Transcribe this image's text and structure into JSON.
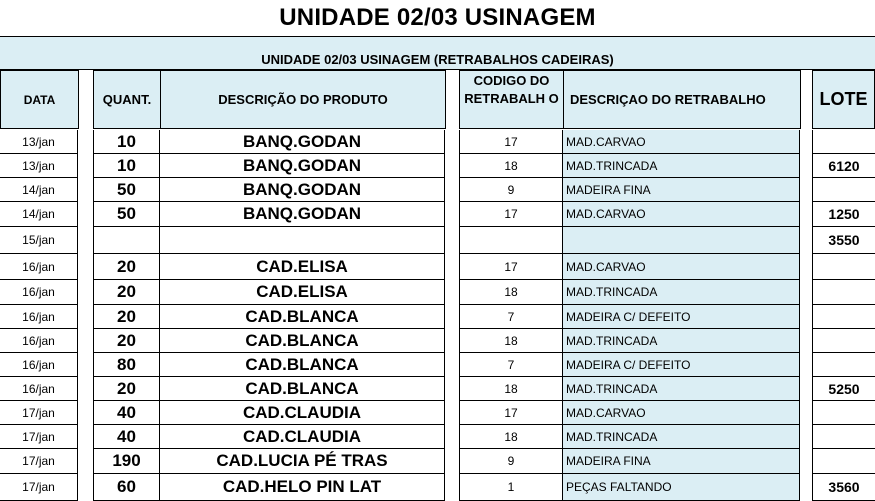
{
  "title": "UNIDADE 02/03 USINAGEM",
  "subtitle": "UNIDADE 02/03 USINAGEM (RETRABALHOS CADEIRAS)",
  "headers": {
    "data": "DATA",
    "quant": "QUANT.",
    "produto": "DESCRIÇÃO DO PRODUTO",
    "codigo": "CODIGO DO RETRABALH O",
    "retrabalho": "DESCRIÇAO DO RETRABALHO",
    "lote": "LOTE"
  },
  "rows": [
    {
      "date": "13/jan",
      "qty": "10",
      "product": "BANQ.GODAN",
      "code": "17",
      "desc": "MAD.CARVAO",
      "lote": ""
    },
    {
      "date": "13/jan",
      "qty": "10",
      "product": "BANQ.GODAN",
      "code": "18",
      "desc": "MAD.TRINCADA",
      "lote": "6120"
    },
    {
      "date": "14/jan",
      "qty": "50",
      "product": "BANQ.GODAN",
      "code": "9",
      "desc": "MADEIRA FINA",
      "lote": ""
    },
    {
      "date": "14/jan",
      "qty": "50",
      "product": "BANQ.GODAN",
      "code": "17",
      "desc": "MAD.CARVAO",
      "lote": "1250"
    },
    {
      "date": "15/jan",
      "qty": "",
      "product": "",
      "code": "",
      "desc": "",
      "lote": "3550"
    },
    {
      "date": "16/jan",
      "qty": "20",
      "product": "CAD.ELISA",
      "code": "17",
      "desc": "MAD.CARVAO",
      "lote": ""
    },
    {
      "date": "16/jan",
      "qty": "20",
      "product": "CAD.ELISA",
      "code": "18",
      "desc": "MAD.TRINCADA",
      "lote": ""
    },
    {
      "date": "16/jan",
      "qty": "20",
      "product": "CAD.BLANCA",
      "code": "7",
      "desc": "MADEIRA C/ DEFEITO",
      "lote": ""
    },
    {
      "date": "16/jan",
      "qty": "20",
      "product": "CAD.BLANCA",
      "code": "18",
      "desc": "MAD.TRINCADA",
      "lote": ""
    },
    {
      "date": "16/jan",
      "qty": "80",
      "product": "CAD.BLANCA",
      "code": "7",
      "desc": "MADEIRA C/ DEFEITO",
      "lote": ""
    },
    {
      "date": "16/jan",
      "qty": "20",
      "product": "CAD.BLANCA",
      "code": "18",
      "desc": "MAD.TRINCADA",
      "lote": "5250"
    },
    {
      "date": "17/jan",
      "qty": "40",
      "product": "CAD.CLAUDIA",
      "code": "17",
      "desc": "MAD.CARVAO",
      "lote": ""
    },
    {
      "date": "17/jan",
      "qty": "40",
      "product": "CAD.CLAUDIA",
      "code": "18",
      "desc": "MAD.TRINCADA",
      "lote": ""
    },
    {
      "date": "17/jan",
      "qty": "190",
      "product": "CAD.LUCIA PÉ TRAS",
      "code": "9",
      "desc": "MADEIRA FINA",
      "lote": ""
    },
    {
      "date": "17/jan",
      "qty": "60",
      "product": "CAD.HELO PIN LAT",
      "code": "1",
      "desc": "PEÇAS FALTANDO",
      "lote": "3560"
    }
  ]
}
